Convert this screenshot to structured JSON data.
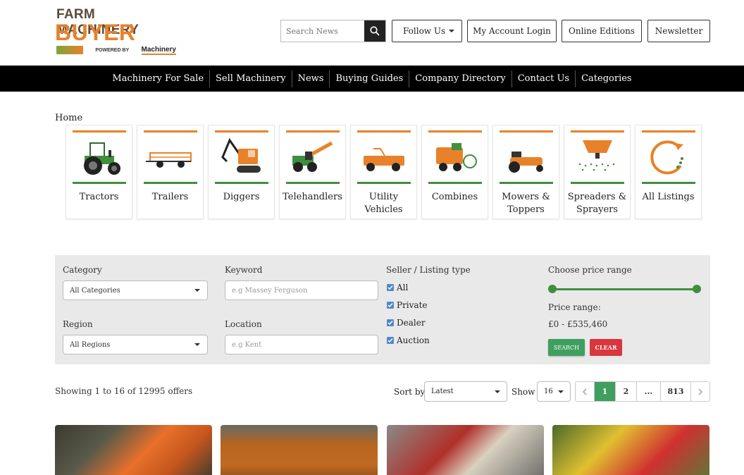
{
  "header": {
    "logo": {
      "line1": "FARM MACHINERY",
      "line2": "BUYER",
      "powered_by": "POWERED BY",
      "brand": "Machinery"
    },
    "search": {
      "placeholder": "Search News"
    },
    "follow_us": "Follow Us",
    "account_login": "My Account Login",
    "online_editions": "Online Editions",
    "newsletter": "Newsletter"
  },
  "nav": {
    "items": [
      "Machinery For Sale",
      "Sell Machinery",
      "News",
      "Buying Guides",
      "Company Directory",
      "Contact Us",
      "Categories"
    ]
  },
  "breadcrumb": "Home",
  "categories": [
    {
      "label": "Tractors",
      "icon": "tractor-icon"
    },
    {
      "label": "Trailers",
      "icon": "trailer-icon"
    },
    {
      "label": "Diggers",
      "icon": "digger-icon"
    },
    {
      "label": "Telehandlers",
      "icon": "telehandler-icon"
    },
    {
      "label": "Utility Vehicles",
      "icon": "utility-vehicle-icon"
    },
    {
      "label": "Combines",
      "icon": "combine-icon"
    },
    {
      "label": "Mowers & Toppers",
      "icon": "mower-icon"
    },
    {
      "label": "Spreaders & Sprayers",
      "icon": "spreader-icon"
    },
    {
      "label": "All Listings",
      "icon": "all-listings-icon"
    }
  ],
  "filter": {
    "category_label": "Category",
    "category_value": "All Categories",
    "keyword_label": "Keyword",
    "keyword_placeholder": "e.g Massey Ferguson",
    "region_label": "Region",
    "region_value": "All Regions",
    "location_label": "Location",
    "location_placeholder": "e.g Kent",
    "seller_label": "Seller / Listing type",
    "seller_types": [
      {
        "label": "All",
        "checked": true
      },
      {
        "label": "Private",
        "checked": true
      },
      {
        "label": "Dealer",
        "checked": true
      },
      {
        "label": "Auction",
        "checked": true
      }
    ],
    "price_label": "Choose price range",
    "price_range_label": "Price range:",
    "price_range_value": "£0 - £535,460",
    "search_button": "SEARCH",
    "clear_button": "CLEAR"
  },
  "results": {
    "showing": "Showing 1 to 16 of 12995 offers",
    "sort_label": "Sort by",
    "sort_value": "Latest",
    "show_label": "Show",
    "show_value": "16",
    "pages": [
      "1",
      "2",
      "...",
      "813"
    ],
    "current_page": "1"
  },
  "colors": {
    "accent_orange": "#e8822a",
    "accent_green": "#3f8f3f",
    "search_green": "#3f9f5f",
    "clear_red": "#d9363e",
    "nav_bg": "#000000"
  }
}
